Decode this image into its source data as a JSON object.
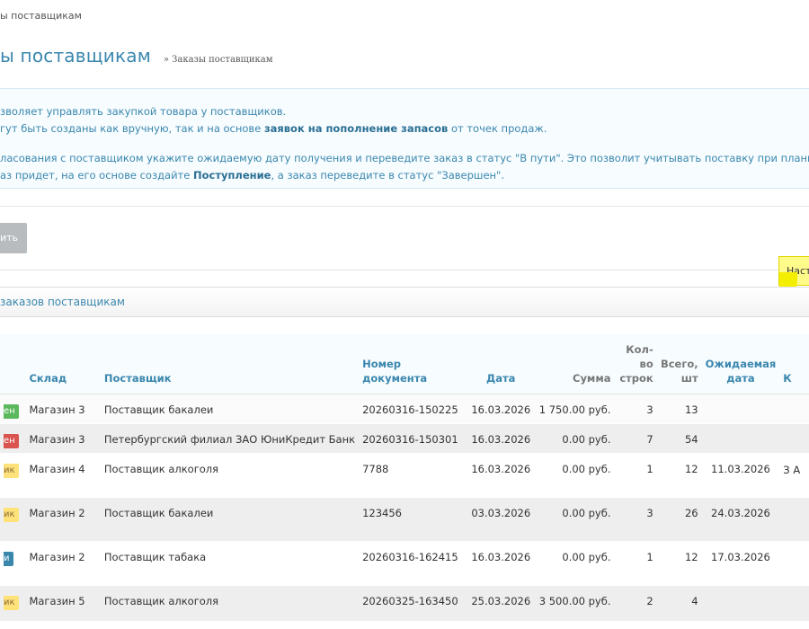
{
  "breadcrumb": "ы поставщикам",
  "page": {
    "title": "ы поставщикам",
    "subtitle": "» Заказы поставщикам"
  },
  "info": {
    "line1": "зволяет управлять закупкой товара у поставщиков.",
    "line2_pre": "гут быть созданы как вручную, так и на основе ",
    "line2_bold": "заявок на пополнение запасов",
    "line2_post": " от точек продаж.",
    "line3": "ласования с поставщиком укажите ожидаемую дату получения и переведите заказ в статус \"В пути\". Это позволит учитывать поставку при планирован",
    "line4_pre": "аз придет, на его основе создайте ",
    "line4_bold": "Поступление",
    "line4_post": ", а заказ переведите в статус \"Завершен\"."
  },
  "toolbar": {
    "add_label": "ить"
  },
  "settings_tab": {
    "label": "Наст"
  },
  "panel": {
    "title": "заказов поставщикам"
  },
  "table": {
    "headers": {
      "warehouse": "Склад",
      "supplier": "Поставщик",
      "doc_number": "Номер документа",
      "date": "Дата",
      "sum": "Сумма",
      "lines": "Кол-во строк",
      "total": "Всего, шт",
      "expected_date": "Ожидаемая дата",
      "comment": "К"
    },
    "rows": [
      {
        "status": "ен",
        "status_color": "#5cb85c",
        "warehouse": "Магазин 3",
        "supplier": "Поставщик бакалеи",
        "doc_number": "20260316-150225",
        "date": "16.03.2026",
        "sum": "1 750.00 руб.",
        "lines": "3",
        "total": "13",
        "expected_date": "",
        "comment": ""
      },
      {
        "status": "ен",
        "status_color": "#d9534f",
        "warehouse": "Магазин 3",
        "supplier": "Петербургский филиал ЗАО ЮниКредит Банк",
        "doc_number": "20260316-150301",
        "date": "16.03.2026",
        "sum": "0.00 руб.",
        "lines": "7",
        "total": "54",
        "expected_date": "",
        "comment": ""
      },
      {
        "status": "ик",
        "status_color": "#ffe27a",
        "warehouse": "Магазин 4",
        "supplier": "Поставщик алкоголя",
        "doc_number": "7788",
        "date": "16.03.2026",
        "sum": "0.00 руб.",
        "lines": "1",
        "total": "12",
        "expected_date": "11.03.2026",
        "comment": "З А"
      },
      {
        "status": "ик",
        "status_color": "#ffe27a",
        "warehouse": "Магазин 2",
        "supplier": "Поставщик бакалеи",
        "doc_number": "123456",
        "date": "03.03.2026",
        "sum": "0.00 руб.",
        "lines": "3",
        "total": "26",
        "expected_date": "24.03.2026",
        "comment": ""
      },
      {
        "status": "и",
        "status_color": "#3a87ad",
        "warehouse": "Магазин 2",
        "supplier": "Поставщик табака",
        "doc_number": "20260316-162415",
        "date": "16.03.2026",
        "sum": "0.00 руб.",
        "lines": "1",
        "total": "12",
        "expected_date": "17.03.2026",
        "comment": ""
      },
      {
        "status": "ик",
        "status_color": "#ffe27a",
        "warehouse": "Магазин 5",
        "supplier": "Поставщик алкоголя",
        "doc_number": "20260325-163450",
        "date": "25.03.2026",
        "sum": "3 500.00 руб.",
        "lines": "2",
        "total": "4",
        "expected_date": "",
        "comment": ""
      }
    ]
  }
}
